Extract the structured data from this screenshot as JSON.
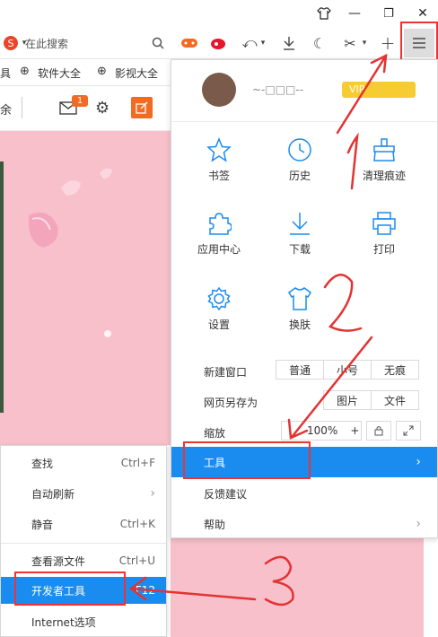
{
  "titlebar": {
    "minimize": "—",
    "restore": "❐",
    "close": "✕"
  },
  "address": {
    "placeholder": "在此搜索"
  },
  "bookmarks": {
    "items": [
      "具",
      "软件大全",
      "影视大全"
    ]
  },
  "page": {
    "strip_text": "余",
    "mail_badge": "1"
  },
  "profile": {
    "name": "~-□□□--",
    "vip": "VIP"
  },
  "grid": [
    {
      "label": "书签"
    },
    {
      "label": "历史"
    },
    {
      "label": "清理痕迹"
    },
    {
      "label": "应用中心"
    },
    {
      "label": "下载"
    },
    {
      "label": "打印"
    },
    {
      "label": "设置"
    },
    {
      "label": "换肤"
    }
  ],
  "new_window": {
    "label": "新建窗口",
    "options": [
      "普通",
      "小号",
      "无痕"
    ]
  },
  "save_as": {
    "label": "网页另存为",
    "options": [
      "图片",
      "文件"
    ]
  },
  "zoom": {
    "label": "缩放",
    "value": "100%",
    "plus": "+"
  },
  "menu": {
    "tools": "工具",
    "feedback": "反馈建议",
    "help": "帮助"
  },
  "submenu": [
    {
      "label": "查找",
      "shortcut": "Ctrl+F"
    },
    {
      "label": "自动刷新",
      "shortcut": "›"
    },
    {
      "label": "静音",
      "shortcut": "Ctrl+K"
    },
    {
      "label": "查看源文件",
      "shortcut": "Ctrl+U"
    },
    {
      "label": "开发者工具",
      "shortcut": "F12"
    },
    {
      "label": "Internet选项",
      "shortcut": ""
    }
  ],
  "annotations": {
    "one": "1",
    "two": "2",
    "three": "3"
  },
  "colors": {
    "accent": "#1a8cf0",
    "pink": "#f7c0cb",
    "annot_red": "#e33333",
    "brand_orange": "#f26b22"
  }
}
